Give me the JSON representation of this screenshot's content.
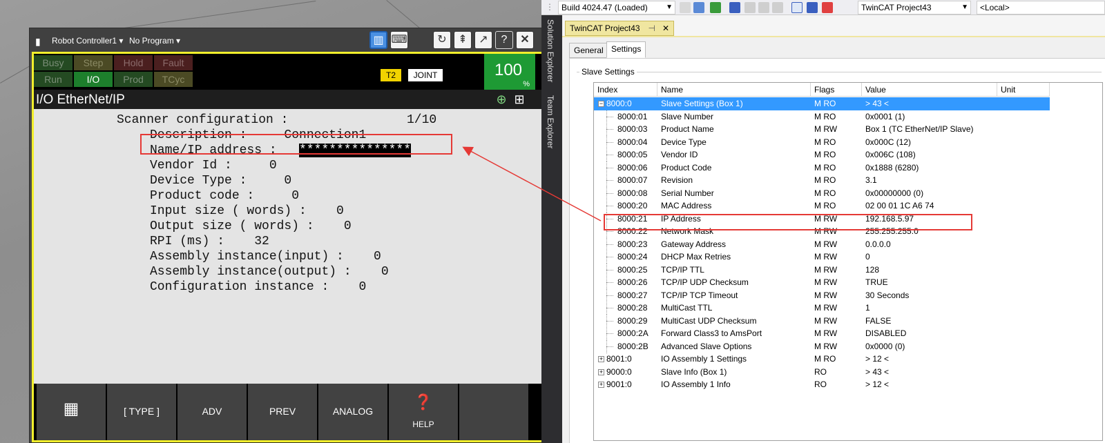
{
  "pendant": {
    "controller": "Robot Controller1 ▾",
    "program": "No Program ▾",
    "status": {
      "busy": "Busy",
      "step": "Step",
      "hold": "Hold",
      "fault": "Fault",
      "run": "Run",
      "io": "I/O",
      "prod": "Prod",
      "tcyc": "TCyc"
    },
    "mode": "T2",
    "coord": "JOINT",
    "speed": "100",
    "speed_unit": "%",
    "screen_title": "I/O EtherNet/IP",
    "lines": {
      "scanner": "Scanner configuration :",
      "page": "1/10",
      "description": "Description :     Connection1",
      "name_ip_label": "Name/IP address :",
      "name_ip_value": "***************",
      "vendor": "Vendor Id :     0",
      "device_type": "Device Type :     0",
      "product_code": "Product code :     0",
      "input_size": "Input size ( words) :    0",
      "output_size": "Output size ( words) :    0",
      "rpi": "RPI (ms) :    32",
      "asm_in": "Assembly instance(input) :    0",
      "asm_out": "Assembly instance(output) :    0",
      "cfg_inst": "Configuration instance :    0"
    },
    "softkeys": {
      "type": "[ TYPE ]",
      "adv": "ADV",
      "prev": "PREV",
      "analog": "ANALOG",
      "help": "HELP"
    }
  },
  "twincat": {
    "build": "Build 4024.47 (Loaded)",
    "project": "TwinCAT Project43",
    "target": "<Local>",
    "side_tabs": [
      "Solution Explorer",
      "Team Explorer"
    ],
    "doc_tab": "TwinCAT Project43",
    "tabs": [
      "General",
      "Settings"
    ],
    "group_label": "Slave Settings",
    "columns": [
      "Index",
      "Name",
      "Flags",
      "Value",
      "Unit"
    ],
    "rows": [
      {
        "index": "8000:0",
        "name": "Slave Settings (Box 1)",
        "flags": "M RO",
        "value": "> 43 <",
        "level": 0,
        "expander": "−"
      },
      {
        "index": "8000:01",
        "name": "Slave Number",
        "flags": "M RO",
        "value": "0x0001 (1)",
        "level": 1
      },
      {
        "index": "8000:03",
        "name": "Product Name",
        "flags": "M RW",
        "value": "Box 1 (TC EtherNet/IP Slave)",
        "level": 1
      },
      {
        "index": "8000:04",
        "name": "Device Type",
        "flags": "M RO",
        "value": "0x000C (12)",
        "level": 1
      },
      {
        "index": "8000:05",
        "name": "Vendor ID",
        "flags": "M RO",
        "value": "0x006C (108)",
        "level": 1
      },
      {
        "index": "8000:06",
        "name": "Product Code",
        "flags": "M RO",
        "value": "0x1888 (6280)",
        "level": 1
      },
      {
        "index": "8000:07",
        "name": "Revision",
        "flags": "M RO",
        "value": "3.1",
        "level": 1
      },
      {
        "index": "8000:08",
        "name": "Serial Number",
        "flags": "M RO",
        "value": "0x00000000 (0)",
        "level": 1
      },
      {
        "index": "8000:20",
        "name": "MAC Address",
        "flags": "M RO",
        "value": "02 00 01 1C A6 74",
        "level": 1
      },
      {
        "index": "8000:21",
        "name": "IP Address",
        "flags": "M RW",
        "value": "192.168.5.97",
        "level": 1
      },
      {
        "index": "8000:22",
        "name": "Network Mask",
        "flags": "M RW",
        "value": "255.255.255.0",
        "level": 1
      },
      {
        "index": "8000:23",
        "name": "Gateway Address",
        "flags": "M RW",
        "value": "0.0.0.0",
        "level": 1
      },
      {
        "index": "8000:24",
        "name": "DHCP Max Retries",
        "flags": "M RW",
        "value": "0",
        "level": 1
      },
      {
        "index": "8000:25",
        "name": "TCP/IP TTL",
        "flags": "M RW",
        "value": "128",
        "level": 1
      },
      {
        "index": "8000:26",
        "name": "TCP/IP UDP Checksum",
        "flags": "M RW",
        "value": "TRUE",
        "level": 1
      },
      {
        "index": "8000:27",
        "name": "TCP/IP TCP Timeout",
        "flags": "M RW",
        "value": "30 Seconds",
        "level": 1
      },
      {
        "index": "8000:28",
        "name": "MultiCast TTL",
        "flags": "M RW",
        "value": "1",
        "level": 1
      },
      {
        "index": "8000:29",
        "name": "MultiCast UDP Checksum",
        "flags": "M RW",
        "value": "FALSE",
        "level": 1
      },
      {
        "index": "8000:2A",
        "name": "Forward Class3 to AmsPort",
        "flags": "M RW",
        "value": "DISABLED",
        "level": 1
      },
      {
        "index": "8000:2B",
        "name": "Advanced Slave Options",
        "flags": "M RW",
        "value": "0x0000 (0)",
        "level": 1
      },
      {
        "index": "8001:0",
        "name": "IO Assembly 1 Settings",
        "flags": "M RO",
        "value": "> 12 <",
        "level": 0,
        "expander": "+"
      },
      {
        "index": "9000:0",
        "name": "Slave Info (Box 1)",
        "flags": "RO",
        "value": "> 43 <",
        "level": 0,
        "expander": "+"
      },
      {
        "index": "9001:0",
        "name": "IO Assembly 1 Info",
        "flags": "RO",
        "value": "> 12 <",
        "level": 0,
        "expander": "+"
      }
    ]
  },
  "colors": {
    "highlight": "#e53935",
    "selection": "#3399ff",
    "pendant_frame": "#f2ef2c"
  }
}
